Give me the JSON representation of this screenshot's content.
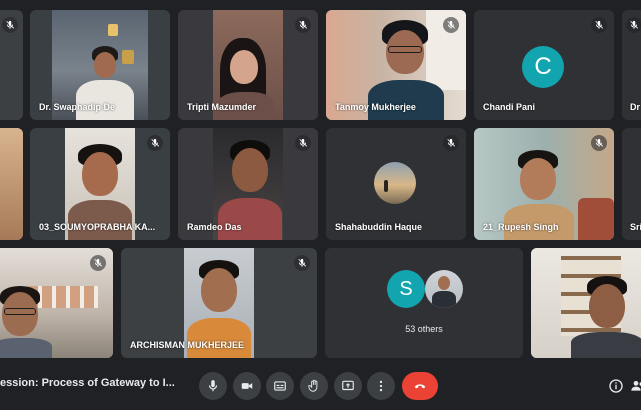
{
  "colors": {
    "background": "#202124",
    "tile": "#3c4043",
    "accent_blue": "#8ab4f8",
    "avatar_teal": "#12a4af",
    "end_call_red": "#ea4335"
  },
  "participants": {
    "swaphadip": {
      "name": "Dr. Swaphadip De"
    },
    "tripti": {
      "name": "Tripti Mazumder"
    },
    "tanmoy": {
      "name": "Tanmoy Mukherjee"
    },
    "chandi": {
      "name": "Chandi Pani",
      "initial": "C"
    },
    "edge_dr": {
      "name": "Dr"
    },
    "soumyoprabha": {
      "name": "03_SOUMYOPRABHA KA..."
    },
    "ramdeo": {
      "name": "Ramdeo Das"
    },
    "shahabuddin": {
      "name": "Shahabuddin Haque"
    },
    "rupesh": {
      "name": "21_Rupesh Singh"
    },
    "edge_sri": {
      "name": "Sri"
    },
    "archisman": {
      "name": "ARCHISMAN MUKHERJEE"
    },
    "others": {
      "label": "53 others",
      "initial": "S"
    }
  },
  "bottom_bar": {
    "meeting_title": "ession: Process of Gateway to I...",
    "icons": [
      "mic-icon",
      "camera-icon",
      "captions-icon",
      "raise-hand-icon",
      "present-icon",
      "more-options-icon",
      "end-call-icon",
      "info-icon",
      "people-icon"
    ]
  }
}
